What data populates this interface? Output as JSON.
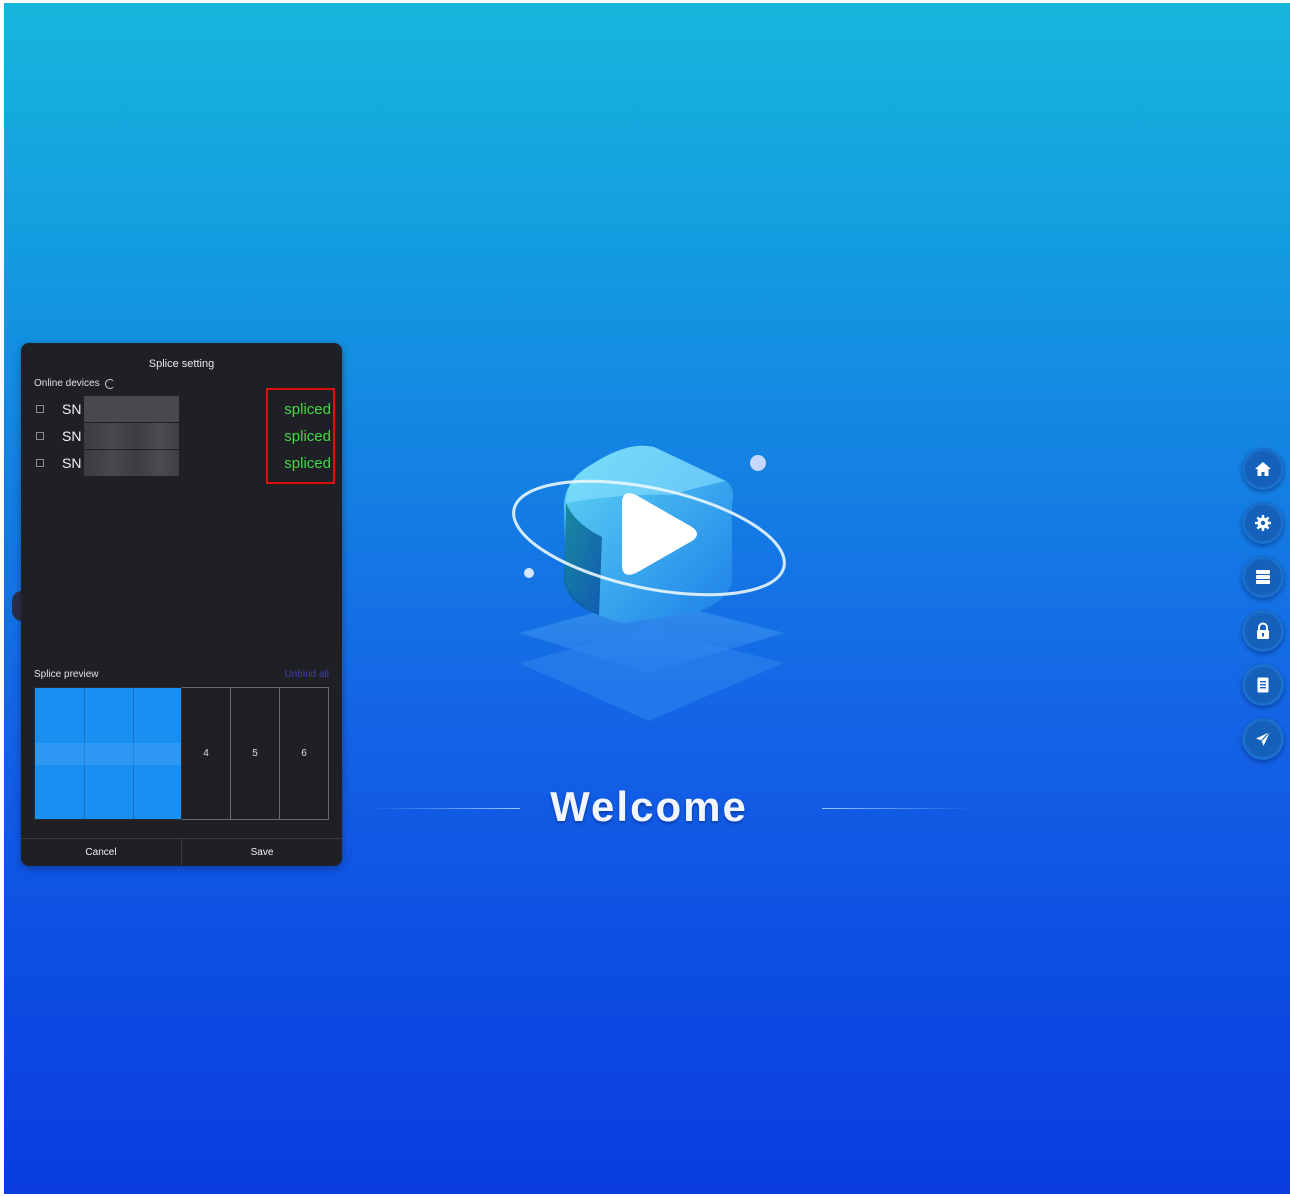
{
  "splice_panel": {
    "title": "Splice setting",
    "online_devices_label": "Online devices",
    "devices": [
      {
        "sn": "SN",
        "status": "spliced"
      },
      {
        "sn": "SN",
        "status": "spliced"
      },
      {
        "sn": "SN",
        "status": "spliced"
      }
    ],
    "preview_label": "Splice preview",
    "unbind_all": "Unbind all",
    "grid_cells": [
      "4",
      "5",
      "6"
    ],
    "cancel": "Cancel",
    "save": "Save"
  },
  "welcome": "Welcome",
  "nav": [
    "home-icon",
    "settings-icon",
    "server-icon",
    "lock-icon",
    "document-icon",
    "send-icon"
  ],
  "colors": {
    "spliced": "#44d744",
    "highlight": "#e01010",
    "panel_bg": "#1f2026"
  }
}
